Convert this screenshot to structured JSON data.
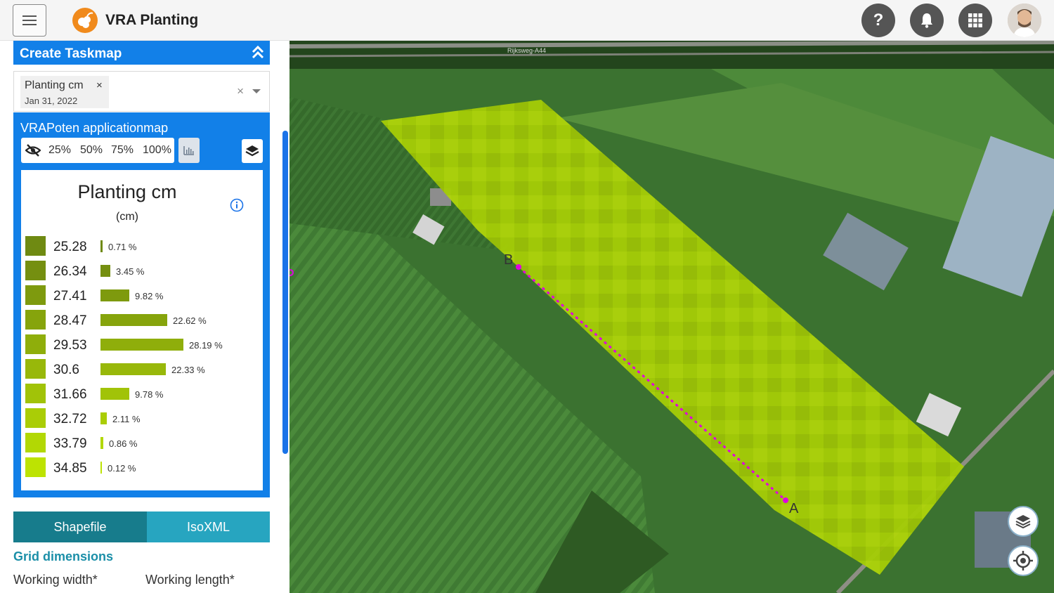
{
  "header": {
    "app_title": "VRA Planting",
    "help_glyph": "?",
    "icons": [
      "menu-icon",
      "logo-icon",
      "help-icon",
      "bell-icon",
      "apps-grid-icon",
      "user-avatar"
    ]
  },
  "sidebar": {
    "section_title": "Create Taskmap",
    "selected_map": {
      "label": "Planting cm",
      "remove_glyph": "×",
      "date": "Jan 31, 2022",
      "clear_glyph": "×"
    },
    "panel": {
      "title": "VRAPoten applicationmap",
      "opacity_options": [
        "25%",
        "50%",
        "75%",
        "100%"
      ]
    },
    "legend": {
      "title": "Planting cm",
      "unit": "(cm)",
      "rows": [
        {
          "value": "25.28",
          "percent": "0.71 %",
          "color": "#6f8a12"
        },
        {
          "value": "26.34",
          "percent": "3.45 %",
          "color": "#758f10"
        },
        {
          "value": "27.41",
          "percent": "9.82 %",
          "color": "#7e9a0e"
        },
        {
          "value": "28.47",
          "percent": "22.62 %",
          "color": "#86a40c"
        },
        {
          "value": "29.53",
          "percent": "28.19 %",
          "color": "#8fae0b"
        },
        {
          "value": "30.6",
          "percent": "22.33 %",
          "color": "#98b80a"
        },
        {
          "value": "31.66",
          "percent": "9.78 %",
          "color": "#a1c308"
        },
        {
          "value": "32.72",
          "percent": "2.11 %",
          "color": "#aacd06"
        },
        {
          "value": "33.79",
          "percent": "0.86 %",
          "color": "#b2d804"
        },
        {
          "value": "34.85",
          "percent": "0.12 %",
          "color": "#bde302"
        }
      ]
    },
    "tabs": [
      "Shapefile",
      "IsoXML"
    ],
    "grid_dimensions": {
      "heading": "Grid dimensions",
      "working_width": "Working width*",
      "working_length": "Working length*"
    }
  },
  "map": {
    "road_label": "Rijksweg-A44",
    "point_a": "A",
    "point_b": "B",
    "line_color": "#e000e0",
    "field_color": "#b6e000"
  }
}
